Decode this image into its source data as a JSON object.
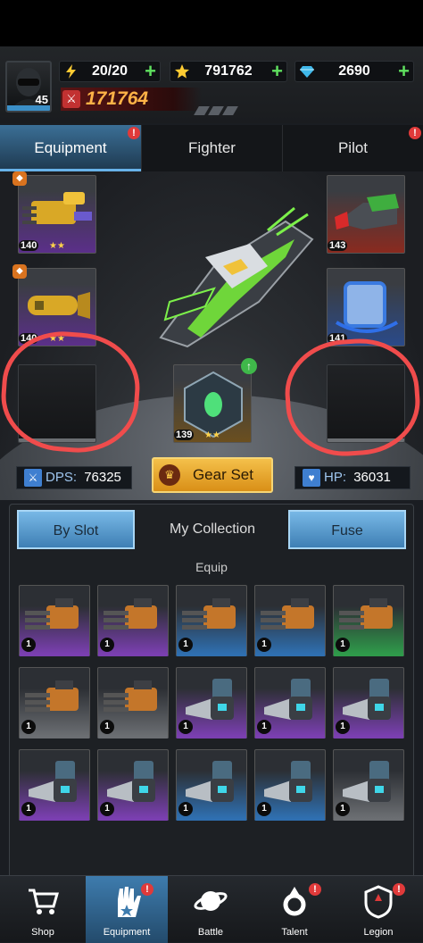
{
  "header": {
    "player_level": "45",
    "energy": "20/20",
    "stars": "791762",
    "gems": "2690",
    "power": "171764"
  },
  "tabs": [
    {
      "label": "Equipment"
    },
    {
      "label": "Fighter"
    },
    {
      "label": "Pilot"
    }
  ],
  "badge_glyph": "!",
  "slots": {
    "left_top": {
      "level": "140",
      "stars": "★★"
    },
    "left_mid": {
      "level": "140",
      "stars": "★★"
    },
    "right_top": {
      "level": "143"
    },
    "right_mid": {
      "level": "141"
    },
    "center": {
      "level": "139",
      "stars": "★★"
    }
  },
  "stats": {
    "dps_label": "DPS:",
    "dps_value": "76325",
    "hp_label": "HP:",
    "hp_value": "36031",
    "gear_set_label": "Gear Set"
  },
  "panel": {
    "tabs": [
      "By Slot",
      "My Collection",
      "Fuse"
    ],
    "section_title": "Equip",
    "items": [
      {
        "level": "1",
        "kind": "gatling",
        "rarity": "purple"
      },
      {
        "level": "1",
        "kind": "gatling",
        "rarity": "purple"
      },
      {
        "level": "1",
        "kind": "gatling",
        "rarity": "blue"
      },
      {
        "level": "1",
        "kind": "gatling",
        "rarity": "blue"
      },
      {
        "level": "1",
        "kind": "gatling",
        "rarity": "green"
      },
      {
        "level": "1",
        "kind": "gatling",
        "rarity": "gray"
      },
      {
        "level": "1",
        "kind": "gatling",
        "rarity": "gray"
      },
      {
        "level": "1",
        "kind": "drill",
        "rarity": "purple"
      },
      {
        "level": "1",
        "kind": "drill",
        "rarity": "purple"
      },
      {
        "level": "1",
        "kind": "drill",
        "rarity": "purple"
      },
      {
        "level": "1",
        "kind": "drill",
        "rarity": "purple"
      },
      {
        "level": "1",
        "kind": "drill",
        "rarity": "purple"
      },
      {
        "level": "1",
        "kind": "drill",
        "rarity": "blue"
      },
      {
        "level": "1",
        "kind": "drill",
        "rarity": "blue"
      },
      {
        "level": "1",
        "kind": "drill",
        "rarity": "gray"
      }
    ]
  },
  "nav": [
    {
      "label": "Shop",
      "icon": "shop-cart-icon"
    },
    {
      "label": "Equipment",
      "icon": "equipment-hand-icon"
    },
    {
      "label": "Battle",
      "icon": "planet-icon"
    },
    {
      "label": "Talent",
      "icon": "talent-gear-icon"
    },
    {
      "label": "Legion",
      "icon": "legion-shield-icon"
    }
  ],
  "colors": {
    "accent": "#3e7cae",
    "gold": "#f4c04a",
    "power": "#ffb347",
    "annotation_circle": "#f04c4c",
    "rarity_purple": "#7a3fb0",
    "rarity_blue": "#2f6fb0",
    "rarity_green": "#2f9a4a",
    "rarity_gray": "#6b6e72"
  }
}
